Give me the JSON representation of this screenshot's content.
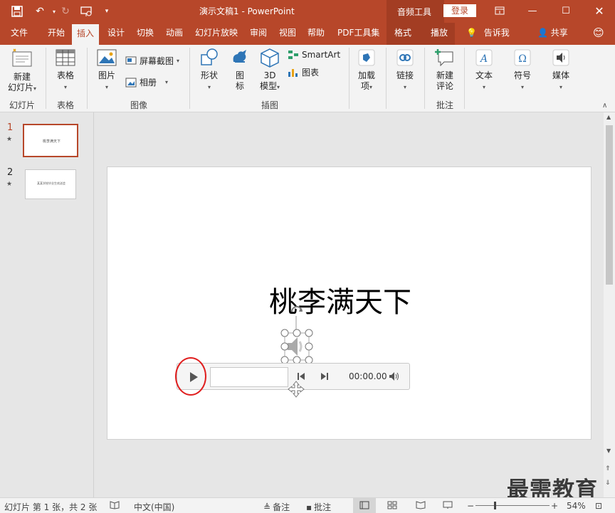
{
  "titlebar": {
    "title": "演示文稿1  -  PowerPoint",
    "context_tools_label": "音频工具",
    "login_label": "登录",
    "icons": [
      "save-icon",
      "undo-icon",
      "redo-icon",
      "slideshow-from-start-icon",
      "customize-qat-icon"
    ]
  },
  "tabs": [
    {
      "label": "文件"
    },
    {
      "label": "开始"
    },
    {
      "label": "插入",
      "active": true
    },
    {
      "label": "设计"
    },
    {
      "label": "切换"
    },
    {
      "label": "动画"
    },
    {
      "label": "幻灯片放映"
    },
    {
      "label": "审阅"
    },
    {
      "label": "视图"
    },
    {
      "label": "帮助"
    },
    {
      "label": "PDF工具集"
    },
    {
      "label": "格式"
    },
    {
      "label": "播放"
    }
  ],
  "tell_me": "告诉我",
  "share": "共享",
  "ribbon": {
    "new_slide": "新建\n幻灯片",
    "table": "表格",
    "pictures": "图片",
    "screenshot": "屏幕截图",
    "album": "相册",
    "shapes": "形状",
    "icons": "图\n标",
    "model3d": "3D\n模型",
    "smartart": "SmartArt",
    "chart": "图表",
    "addins": "加载\n项",
    "links": "链接",
    "new_comment": "新建\n评论",
    "text": "文本",
    "symbols": "符号",
    "media": "媒体",
    "groups": {
      "slides": "幻灯片",
      "tables": "表格",
      "images": "图像",
      "illustrations": "插图",
      "comments": "批注"
    }
  },
  "thumbnails": [
    {
      "num": "1",
      "text": "桃李满天下",
      "selected": true
    },
    {
      "num": "2",
      "text": "某某学校毕业生欢送会",
      "selected": false
    }
  ],
  "slide": {
    "title": "桃李满天下"
  },
  "player": {
    "time": "00:00.00"
  },
  "statusbar": {
    "slide_info": "幻灯片 第 1 张，共 2 张",
    "language": "中文(中国)",
    "notes": "备注",
    "comments": "批注",
    "zoom": "54%"
  },
  "watermark": "最需教育",
  "colors": {
    "accent": "#b7472a",
    "highlight_circle": "#e01f1f"
  }
}
